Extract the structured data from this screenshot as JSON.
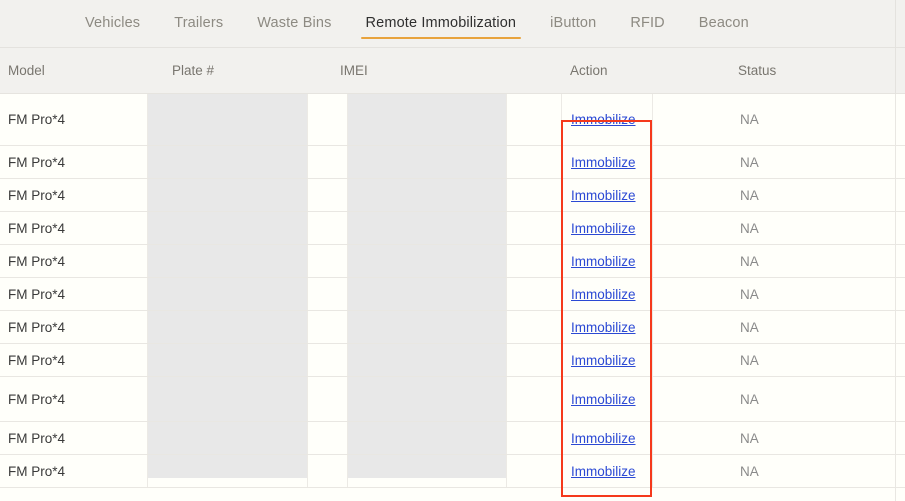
{
  "tabs": [
    {
      "label": "Vehicles",
      "active": false
    },
    {
      "label": "Trailers",
      "active": false
    },
    {
      "label": "Waste Bins",
      "active": false
    },
    {
      "label": "Remote Immobilization",
      "active": true
    },
    {
      "label": "iButton",
      "active": false
    },
    {
      "label": "RFID",
      "active": false
    },
    {
      "label": "Beacon",
      "active": false
    }
  ],
  "table": {
    "columns": [
      {
        "key": "model",
        "label": "Model"
      },
      {
        "key": "plate",
        "label": "Plate #"
      },
      {
        "key": "imei",
        "label": "IMEI"
      },
      {
        "key": "action",
        "label": "Action"
      },
      {
        "key": "status",
        "label": "Status"
      }
    ],
    "rows": [
      {
        "model": "FM Pro*4",
        "plate": "",
        "imei": "",
        "action": "Immobilize",
        "status": "NA"
      },
      {
        "model": "FM Pro*4",
        "plate": "",
        "imei": "",
        "action": "Immobilize",
        "status": "NA"
      },
      {
        "model": "FM Pro*4",
        "plate": "",
        "imei": "",
        "action": "Immobilize",
        "status": "NA"
      },
      {
        "model": "FM Pro*4",
        "plate": "",
        "imei": "",
        "action": "Immobilize",
        "status": "NA"
      },
      {
        "model": "FM Pro*4",
        "plate": "",
        "imei": "",
        "action": "Immobilize",
        "status": "NA"
      },
      {
        "model": "FM Pro*4",
        "plate": "",
        "imei": "",
        "action": "Immobilize",
        "status": "NA"
      },
      {
        "model": "FM Pro*4",
        "plate": "",
        "imei": "",
        "action": "Immobilize",
        "status": "NA"
      },
      {
        "model": "FM Pro*4",
        "plate": "",
        "imei": "",
        "action": "Immobilize",
        "status": "NA"
      },
      {
        "model": "FM Pro*4",
        "plate": "",
        "imei": "",
        "action": "Immobilize",
        "status": "NA"
      },
      {
        "model": "FM Pro*4",
        "plate": "",
        "imei": "",
        "action": "Immobilize",
        "status": "NA"
      },
      {
        "model": "FM Pro*4",
        "plate": "",
        "imei": "",
        "action": "Immobilize",
        "status": "NA"
      }
    ]
  },
  "colors": {
    "accent": "#e8a33d",
    "link": "#2b49d4",
    "annotation": "#f5391c",
    "header_bg": "#f2f1ee",
    "body_bg": "#fffffa",
    "redaction": "#e8e8e8"
  }
}
